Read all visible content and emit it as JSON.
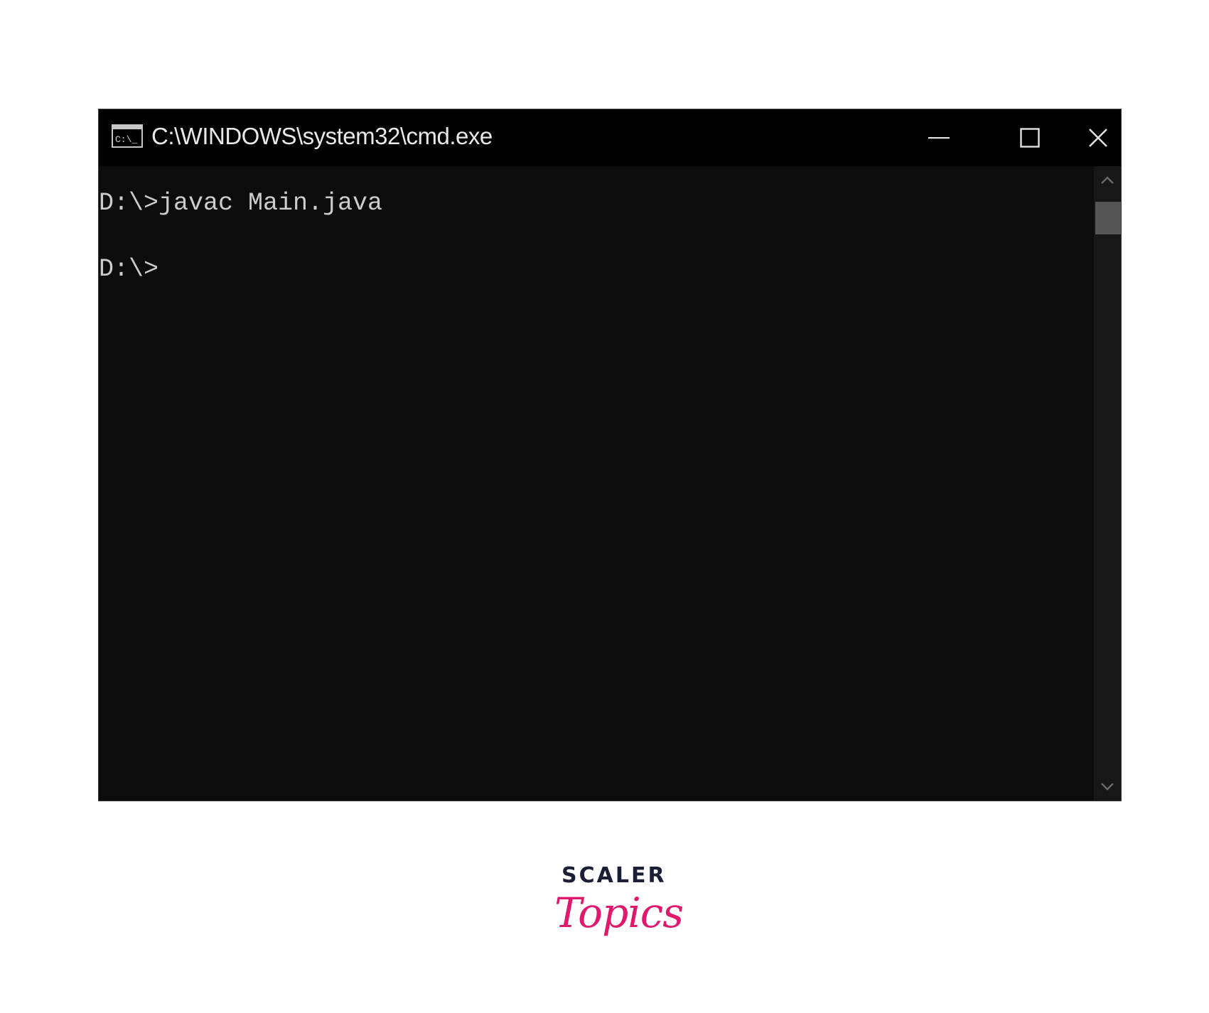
{
  "window": {
    "title": "C:\\WINDOWS\\system32\\cmd.exe",
    "app_icon": "console-icon",
    "controls": {
      "minimize_icon": "minimize-icon",
      "maximize_icon": "maximize-icon",
      "close_icon": "close-icon"
    }
  },
  "console": {
    "lines": [
      "D:\\>javac Main.java",
      "D:\\>"
    ],
    "text_color": "#cccccc",
    "background": "#0c0c0c"
  },
  "scrollbar": {
    "up_icon": "chevron-up-icon",
    "down_icon": "chevron-down-icon"
  },
  "logo": {
    "brand": "SCALER",
    "sub": "Topics",
    "brand_color": "#1a1f36",
    "accent_color": "#e0196d"
  }
}
